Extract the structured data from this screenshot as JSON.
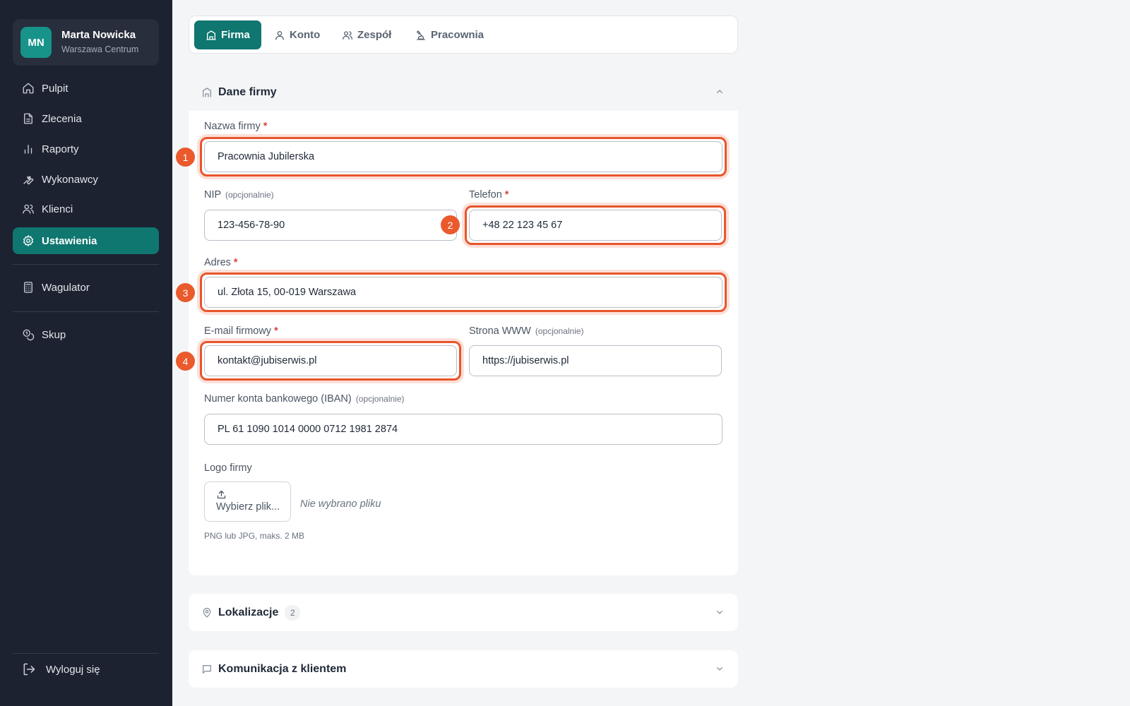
{
  "user": {
    "initials": "MN",
    "name": "Marta Nowicka",
    "location": "Warszawa Centrum"
  },
  "sidebar": {
    "items": [
      {
        "label": "Pulpit",
        "icon": "home-icon"
      },
      {
        "label": "Zlecenia",
        "icon": "document-icon"
      },
      {
        "label": "Raporty",
        "icon": "bar-chart-icon"
      },
      {
        "label": "Wykonawcy",
        "icon": "wrench-icon"
      },
      {
        "label": "Klienci",
        "icon": "users-icon"
      },
      {
        "label": "Ustawienia",
        "icon": "gear-icon",
        "active": true
      },
      {
        "label": "Wagulator",
        "icon": "calculator-icon"
      },
      {
        "label": "Skup",
        "icon": "coins-icon"
      }
    ],
    "logout": "Wyloguj się"
  },
  "tabs": [
    {
      "label": "Firma",
      "icon": "building-icon",
      "active": true
    },
    {
      "label": "Konto",
      "icon": "user-icon"
    },
    {
      "label": "Zespół",
      "icon": "team-icon"
    },
    {
      "label": "Pracownia",
      "icon": "workshop-icon"
    }
  ],
  "sections": {
    "company": {
      "title": "Dane firmy"
    },
    "locations": {
      "title": "Lokalizacje",
      "count": "2"
    },
    "communication": {
      "title": "Komunikacja z klientem"
    }
  },
  "form": {
    "company_name": {
      "label": "Nazwa firmy",
      "required": "*",
      "value": "Pracownia Jubilerska"
    },
    "nip": {
      "label": "NIP",
      "optional": "(opcjonalnie)",
      "value": "123-456-78-90"
    },
    "phone": {
      "label": "Telefon",
      "required": "*",
      "value": "+48 22 123 45 67"
    },
    "address": {
      "label": "Adres",
      "required": "*",
      "value": "ul. Złota 15, 00-019 Warszawa"
    },
    "email": {
      "label": "E-mail firmowy",
      "required": "*",
      "value": "kontakt@jubiserwis.pl"
    },
    "website": {
      "label": "Strona WWW",
      "optional": "(opcjonalnie)",
      "value": "https://jubiserwis.pl"
    },
    "iban": {
      "label": "Numer konta bankowego (IBAN)",
      "optional": "(opcjonalnie)",
      "value": "PL 61 1090 1014 0000 0712 1981 2874"
    },
    "logo": {
      "label": "Logo firmy",
      "button": "Wybierz plik...",
      "no_file": "Nie wybrano pliku",
      "hint": "PNG lub JPG, maks. 2 MB"
    }
  },
  "markers": [
    "1",
    "2",
    "3",
    "4"
  ],
  "colors": {
    "sidebar_bg": "#1c2230",
    "accent": "#0f7670",
    "highlight": "#e8552a",
    "required": "#d6453a"
  }
}
